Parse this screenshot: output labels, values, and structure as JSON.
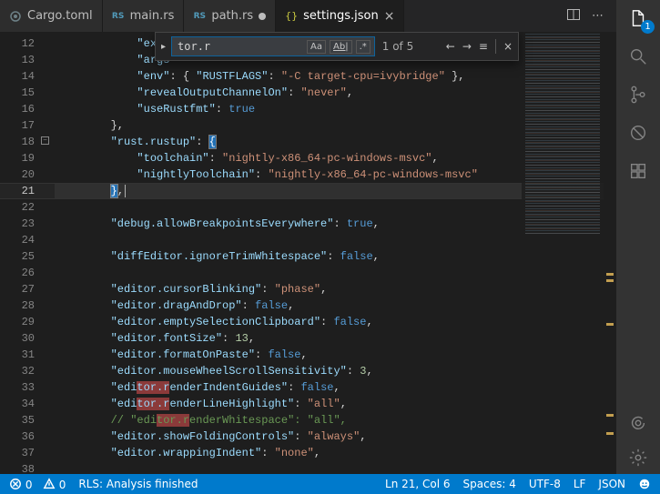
{
  "tabs": [
    {
      "label": "Cargo.toml",
      "icon": "toml",
      "state": "clean"
    },
    {
      "label": "main.rs",
      "icon": "rs",
      "state": "clean"
    },
    {
      "label": "path.rs",
      "icon": "rs",
      "state": "dirty"
    },
    {
      "label": "settings.json",
      "icon": "json",
      "state": "active"
    }
  ],
  "find": {
    "value": "tor.r",
    "result_label": "1 of 5",
    "case_sensitive_label": "Aa",
    "whole_word_label": "Ab|",
    "regex_label": ".*"
  },
  "activity": {
    "explorer_badge": "1"
  },
  "editor": {
    "current_line": 21,
    "lines": [
      {
        "no": 12,
        "tokens": [
          {
            "t": "            ",
            "c": ""
          },
          {
            "t": "\"execu",
            "c": "cyan"
          }
        ]
      },
      {
        "no": 13,
        "tokens": [
          {
            "t": "            ",
            "c": ""
          },
          {
            "t": "\"args\"",
            "c": "cyan"
          }
        ]
      },
      {
        "no": 14,
        "tokens": [
          {
            "t": "            ",
            "c": ""
          },
          {
            "t": "\"env\"",
            "c": "cyan"
          },
          {
            "t": ": { ",
            "c": ""
          },
          {
            "t": "\"RUSTFLAGS\"",
            "c": "cyan"
          },
          {
            "t": ": ",
            "c": ""
          },
          {
            "t": "\"-C target-cpu=ivybridge\"",
            "c": "str"
          },
          {
            "t": " },",
            "c": ""
          }
        ]
      },
      {
        "no": 15,
        "tokens": [
          {
            "t": "            ",
            "c": ""
          },
          {
            "t": "\"revealOutputChannelOn\"",
            "c": "cyan"
          },
          {
            "t": ": ",
            "c": ""
          },
          {
            "t": "\"never\"",
            "c": "str"
          },
          {
            "t": ",",
            "c": ""
          }
        ]
      },
      {
        "no": 16,
        "tokens": [
          {
            "t": "            ",
            "c": ""
          },
          {
            "t": "\"useRustfmt\"",
            "c": "cyan"
          },
          {
            "t": ": ",
            "c": ""
          },
          {
            "t": "true",
            "c": "blue"
          }
        ]
      },
      {
        "no": 17,
        "tokens": [
          {
            "t": "        ",
            "c": ""
          },
          {
            "t": "},",
            "c": ""
          }
        ]
      },
      {
        "no": 18,
        "fold": true,
        "tokens": [
          {
            "t": "        ",
            "c": ""
          },
          {
            "t": "\"rust.rustup\"",
            "c": "cyan"
          },
          {
            "t": ": ",
            "c": ""
          },
          {
            "t": "{",
            "c": "brace-hl"
          }
        ]
      },
      {
        "no": 19,
        "tokens": [
          {
            "t": "            ",
            "c": ""
          },
          {
            "t": "\"toolchain\"",
            "c": "cyan"
          },
          {
            "t": ": ",
            "c": ""
          },
          {
            "t": "\"nightly-x86_64-pc-windows-msvc\"",
            "c": "str"
          },
          {
            "t": ",",
            "c": ""
          }
        ]
      },
      {
        "no": 20,
        "tokens": [
          {
            "t": "            ",
            "c": ""
          },
          {
            "t": "\"nightlyToolchain\"",
            "c": "cyan"
          },
          {
            "t": ": ",
            "c": ""
          },
          {
            "t": "\"nightly-x86_64-pc-windows-msvc\"",
            "c": "str"
          }
        ]
      },
      {
        "no": 21,
        "tokens": [
          {
            "t": "        ",
            "c": ""
          },
          {
            "t": "}",
            "c": "brace-hl"
          },
          {
            "t": ",",
            "c": ""
          }
        ]
      },
      {
        "no": 22,
        "tokens": []
      },
      {
        "no": 23,
        "tokens": [
          {
            "t": "        ",
            "c": ""
          },
          {
            "t": "\"debug.allowBreakpointsEverywhere\"",
            "c": "cyan"
          },
          {
            "t": ": ",
            "c": ""
          },
          {
            "t": "true",
            "c": "blue"
          },
          {
            "t": ",",
            "c": ""
          }
        ]
      },
      {
        "no": 24,
        "tokens": []
      },
      {
        "no": 25,
        "tokens": [
          {
            "t": "        ",
            "c": ""
          },
          {
            "t": "\"diffEditor.ignoreTrimWhitespace\"",
            "c": "cyan"
          },
          {
            "t": ": ",
            "c": ""
          },
          {
            "t": "false",
            "c": "blue"
          },
          {
            "t": ",",
            "c": ""
          }
        ]
      },
      {
        "no": 26,
        "tokens": []
      },
      {
        "no": 27,
        "tokens": [
          {
            "t": "        ",
            "c": ""
          },
          {
            "t": "\"editor.cursorBlinking\"",
            "c": "cyan"
          },
          {
            "t": ": ",
            "c": ""
          },
          {
            "t": "\"phase\"",
            "c": "str"
          },
          {
            "t": ",",
            "c": ""
          }
        ]
      },
      {
        "no": 28,
        "tokens": [
          {
            "t": "        ",
            "c": ""
          },
          {
            "t": "\"editor.dragAndDrop\"",
            "c": "cyan"
          },
          {
            "t": ": ",
            "c": ""
          },
          {
            "t": "false",
            "c": "blue"
          },
          {
            "t": ",",
            "c": ""
          }
        ]
      },
      {
        "no": 29,
        "tokens": [
          {
            "t": "        ",
            "c": ""
          },
          {
            "t": "\"editor.emptySelectionClipboard\"",
            "c": "cyan"
          },
          {
            "t": ": ",
            "c": ""
          },
          {
            "t": "false",
            "c": "blue"
          },
          {
            "t": ",",
            "c": ""
          }
        ]
      },
      {
        "no": 30,
        "tokens": [
          {
            "t": "        ",
            "c": ""
          },
          {
            "t": "\"editor.fontSize\"",
            "c": "cyan"
          },
          {
            "t": ": ",
            "c": ""
          },
          {
            "t": "13",
            "c": "num"
          },
          {
            "t": ",",
            "c": ""
          }
        ]
      },
      {
        "no": 31,
        "tokens": [
          {
            "t": "        ",
            "c": ""
          },
          {
            "t": "\"editor.formatOnPaste\"",
            "c": "cyan"
          },
          {
            "t": ": ",
            "c": ""
          },
          {
            "t": "false",
            "c": "blue"
          },
          {
            "t": ",",
            "c": ""
          }
        ]
      },
      {
        "no": 32,
        "tokens": [
          {
            "t": "        ",
            "c": ""
          },
          {
            "t": "\"editor.mouseWheelScrollSensitivity\"",
            "c": "cyan"
          },
          {
            "t": ": ",
            "c": ""
          },
          {
            "t": "3",
            "c": "num"
          },
          {
            "t": ",",
            "c": ""
          }
        ]
      },
      {
        "no": 33,
        "selection": [
          4,
          9
        ],
        "tokens": [
          {
            "t": "        ",
            "c": ""
          },
          {
            "t": "\"edi",
            "c": "cyan"
          },
          {
            "t": "tor.r",
            "c": "cyan sel-hl"
          },
          {
            "t": "enderIndentGuides\"",
            "c": "cyan"
          },
          {
            "t": ": ",
            "c": ""
          },
          {
            "t": "false",
            "c": "blue"
          },
          {
            "t": ",",
            "c": ""
          }
        ]
      },
      {
        "no": 34,
        "tokens": [
          {
            "t": "        ",
            "c": ""
          },
          {
            "t": "\"edi",
            "c": "cyan"
          },
          {
            "t": "tor.r",
            "c": "cyan sel-hl"
          },
          {
            "t": "enderLineHighlight\"",
            "c": "cyan"
          },
          {
            "t": ": ",
            "c": ""
          },
          {
            "t": "\"all\"",
            "c": "str"
          },
          {
            "t": ",",
            "c": ""
          }
        ]
      },
      {
        "no": 35,
        "tokens": [
          {
            "t": "        ",
            "c": ""
          },
          {
            "t": "// \"edi",
            "c": "comment"
          },
          {
            "t": "tor.r",
            "c": "comment sel-hl"
          },
          {
            "t": "enderWhitespace\": \"all\",",
            "c": "comment"
          }
        ]
      },
      {
        "no": 36,
        "tokens": [
          {
            "t": "        ",
            "c": ""
          },
          {
            "t": "\"editor.showFoldingControls\"",
            "c": "cyan"
          },
          {
            "t": ": ",
            "c": ""
          },
          {
            "t": "\"always\"",
            "c": "str"
          },
          {
            "t": ",",
            "c": ""
          }
        ]
      },
      {
        "no": 37,
        "tokens": [
          {
            "t": "        ",
            "c": ""
          },
          {
            "t": "\"editor.wrappingIndent\"",
            "c": "cyan"
          },
          {
            "t": ": ",
            "c": ""
          },
          {
            "t": "\"none\"",
            "c": "str"
          },
          {
            "t": ",",
            "c": ""
          }
        ]
      },
      {
        "no": 38,
        "tokens": []
      }
    ]
  },
  "status": {
    "errors": "0",
    "warnings": "0",
    "rls": "RLS: Analysis finished",
    "cursor": "Ln 21, Col 6",
    "spaces": "Spaces: 4",
    "encoding": "UTF-8",
    "eol": "LF",
    "language": "JSON"
  }
}
